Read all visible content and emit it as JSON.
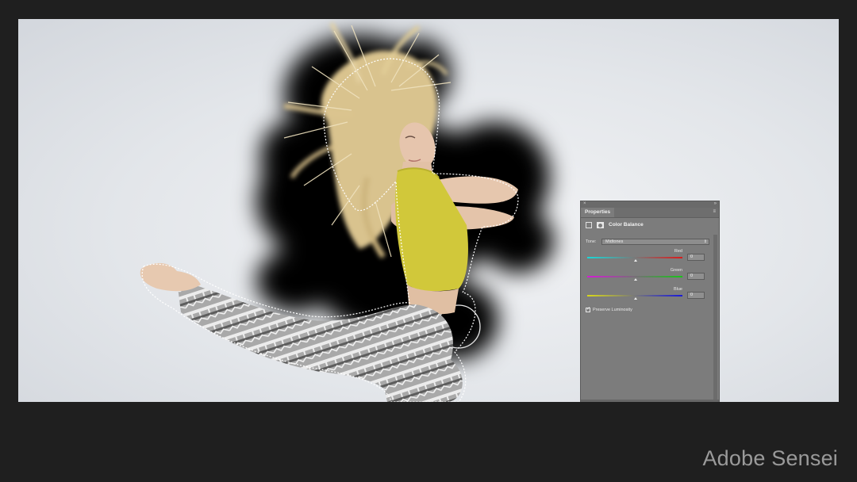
{
  "panel": {
    "tab_label": "Properties",
    "close_glyph": "×",
    "collapse_glyph": "»",
    "menu_glyph": "≡",
    "adjustment_title": "Color Balance",
    "adjustment_icon": "balance-icon",
    "mask_icon": "mask-icon",
    "tone_label": "Tone:",
    "tone_value": "Midtones",
    "sliders": [
      {
        "name": "Red",
        "value": "0",
        "track_from": "#19d8d8",
        "track_to": "#d91b1b"
      },
      {
        "name": "Green",
        "value": "0",
        "track_from": "#d619d6",
        "track_to": "#18c418"
      },
      {
        "name": "Blue",
        "value": "0",
        "track_from": "#d8d81a",
        "track_to": "#1a1ad8"
      }
    ],
    "preserve_luminosity_label": "Preserve Luminosity",
    "preserve_luminosity_checked": true
  },
  "brand": {
    "text": "Adobe Sensei"
  },
  "colors": {
    "frame_bg": "#1f1f1f",
    "panel_bg": "#7c7c7c",
    "mask": "#000000",
    "top": "#d4cd3a"
  }
}
